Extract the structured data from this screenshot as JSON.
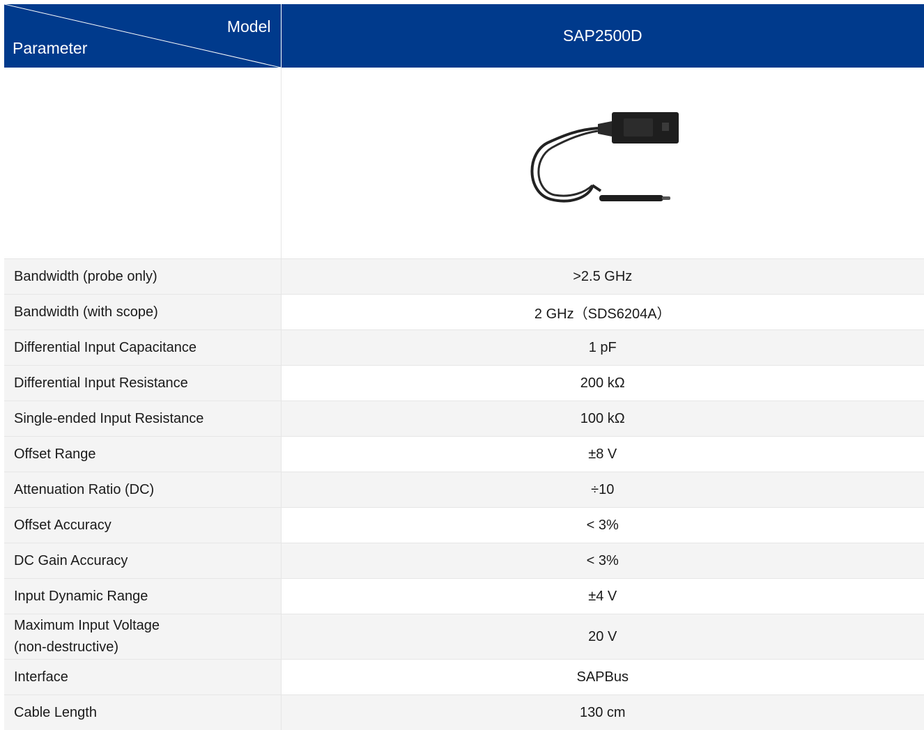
{
  "header": {
    "model_label": "Model",
    "parameter_label": "Parameter",
    "model_name": "SAP2500D"
  },
  "image": {
    "description_icon": "differential-probe-image"
  },
  "rows": [
    {
      "param": "Bandwidth (probe only)",
      "value": ">2.5 GHz"
    },
    {
      "param": "Bandwidth (with scope)",
      "value": "2 GHz（SDS6204A）"
    },
    {
      "param": "Differential Input Capacitance",
      "value": "1 pF"
    },
    {
      "param": "Differential Input Resistance",
      "value": "200 kΩ"
    },
    {
      "param": "Single-ended Input Resistance",
      "value": "100 kΩ"
    },
    {
      "param": "Offset Range",
      "value": "±8 V"
    },
    {
      "param": "Attenuation Ratio (DC)",
      "value": "÷10"
    },
    {
      "param": "Offset Accuracy",
      "value": "< 3%"
    },
    {
      "param": "DC Gain Accuracy",
      "value": "< 3%"
    },
    {
      "param": "Input Dynamic Range",
      "value": "±4 V"
    },
    {
      "param_line1": "Maximum Input Voltage",
      "param_line2": "(non-destructive)",
      "value": "20 V"
    },
    {
      "param": "Interface",
      "value": "SAPBus"
    },
    {
      "param": "Cable Length",
      "value": "130 cm"
    }
  ],
  "colors": {
    "header_bg": "#003a8c",
    "row_alt_bg": "#f4f4f4",
    "divider": "#e6e6e6"
  }
}
